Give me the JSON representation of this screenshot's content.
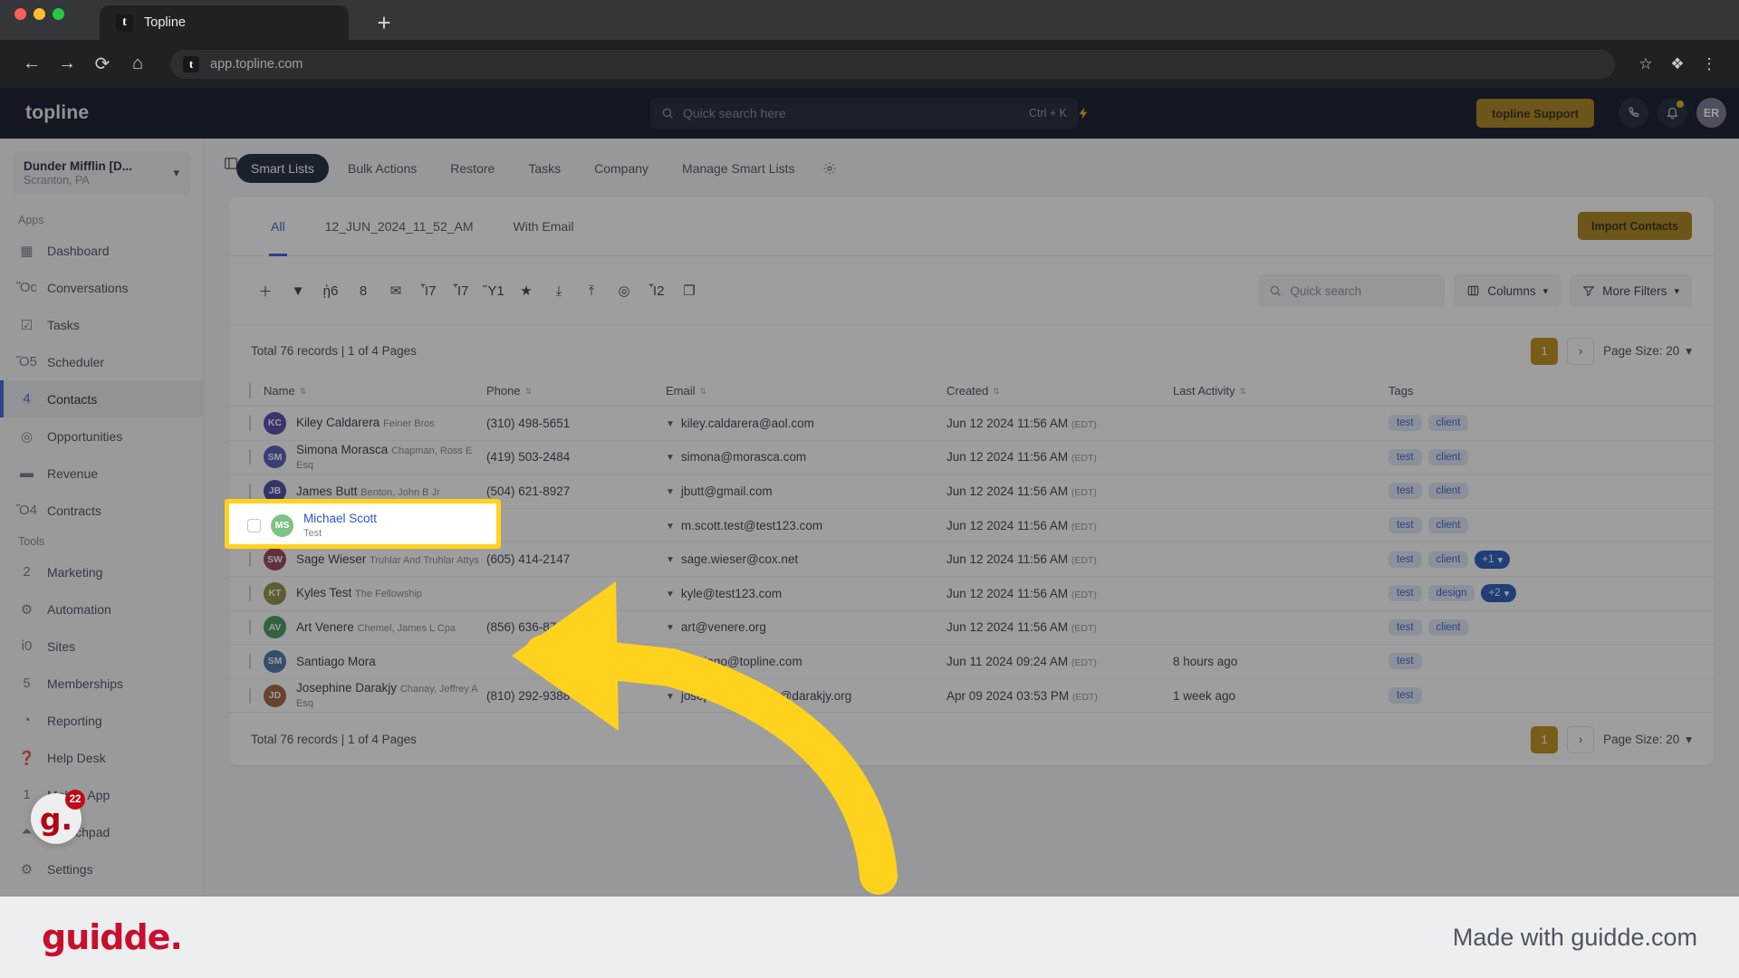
{
  "browser": {
    "tab_title": "Topline",
    "tab_favicon_letter": "t",
    "new_tab_label": "+",
    "url": "app.topline.com",
    "url_favicon_letter": "t",
    "nav": {
      "back": "←",
      "forward": "→",
      "reload": "⟳",
      "home": "⌂"
    },
    "omni": {
      "star": "☆",
      "extensions": "❖",
      "menu": "⋮"
    }
  },
  "topbar": {
    "brand": "topline",
    "search_placeholder": "Quick search here",
    "search_shortcut": "Ctrl + K",
    "bolt_icon": "⚡",
    "support_button": "topline Support",
    "phone_icon": "✆",
    "bell_icon": "ὑ4",
    "avatar_initials": "ER"
  },
  "sidebar": {
    "org_name": "Dunder Mifflin [D...",
    "org_location": "Scranton, PA",
    "org_chevron": "⌄",
    "collapse_icon": "◫",
    "section_apps": "Apps",
    "section_tools": "Tools",
    "apps": [
      {
        "label": "Dashboard",
        "icon": "▦",
        "active": false
      },
      {
        "label": "Conversations",
        "icon": "Ὂc",
        "active": false
      },
      {
        "label": "Tasks",
        "icon": "☑",
        "active": false
      },
      {
        "label": "Scheduler",
        "icon": "Ὄ5",
        "active": false
      },
      {
        "label": "Contacts",
        "icon": "὆4",
        "active": true
      },
      {
        "label": "Opportunities",
        "icon": "◎",
        "active": false
      },
      {
        "label": "Revenue",
        "icon": "▬",
        "active": false
      },
      {
        "label": "Contracts",
        "icon": "Ὄ4",
        "active": false
      }
    ],
    "tools": [
      {
        "label": "Marketing",
        "icon": "὎2",
        "active": false
      },
      {
        "label": "Automation",
        "icon": "⚙",
        "active": false
      },
      {
        "label": "Sites",
        "icon": "ἱ0",
        "active": false
      },
      {
        "label": "Memberships",
        "icon": "὆5",
        "active": false
      },
      {
        "label": "Reporting",
        "icon": "◔",
        "active": false
      },
      {
        "label": "Help Desk",
        "icon": "❓",
        "active": false
      },
      {
        "label": "Mobile App",
        "icon": "὏1",
        "active": false
      },
      {
        "label": "Launchpad",
        "icon": "⏶",
        "active": false
      },
      {
        "label": "Settings",
        "icon": "⚙",
        "active": false
      }
    ],
    "guidde_widget_letter": "g.",
    "guidde_widget_badge": "22"
  },
  "main": {
    "nav_tabs": [
      {
        "label": "Smart Lists",
        "active": true
      },
      {
        "label": "Bulk Actions",
        "active": false
      },
      {
        "label": "Restore",
        "active": false
      },
      {
        "label": "Tasks",
        "active": false
      },
      {
        "label": "Company",
        "active": false
      },
      {
        "label": "Manage Smart Lists",
        "active": false
      }
    ],
    "nav_gear_icon": "⚙",
    "filter_tabs": [
      {
        "label": "All",
        "active": true
      },
      {
        "label": "12_JUN_2024_11_52_AM",
        "active": false
      },
      {
        "label": "With Email",
        "active": false
      }
    ],
    "import_button": "Import Contacts",
    "toolbar_icons": [
      {
        "name": "add-contact-icon",
        "glyph": "＋"
      },
      {
        "name": "filter-icon",
        "glyph": "▼"
      },
      {
        "name": "bot-icon",
        "glyph": "ᾑ6"
      },
      {
        "name": "sms-icon",
        "glyph": "὞8"
      },
      {
        "name": "email-icon",
        "glyph": "✉"
      },
      {
        "name": "add-tag-icon",
        "glyph": "Ἷ7"
      },
      {
        "name": "remove-tag-icon",
        "glyph": "Ἷ7"
      },
      {
        "name": "delete-icon",
        "glyph": "Ὕ1"
      },
      {
        "name": "favorite-icon",
        "glyph": "★"
      },
      {
        "name": "import-icon",
        "glyph": "⤓"
      },
      {
        "name": "export-icon",
        "glyph": "⤒"
      },
      {
        "name": "assign-owner-icon",
        "glyph": "◎"
      },
      {
        "name": "merge-icon",
        "glyph": "Ἶ2"
      },
      {
        "name": "restore-icon",
        "glyph": "❐"
      }
    ],
    "toolbar_search_placeholder": "Quick search",
    "columns_button": "Columns",
    "more_filters_button": "More Filters",
    "columns_icon": "⌸",
    "filter_funnel_icon": "▽",
    "chevron_down": "⌄",
    "records_summary": "Total 76 records | 1 of 4 Pages",
    "pagination": {
      "current_page": "1",
      "next_icon": "›",
      "page_size_label": "Page Size: 20",
      "page_size_chevron": "▾"
    },
    "table": {
      "headers": [
        "Name",
        "Phone",
        "Email",
        "Created",
        "Last Activity",
        "Tags"
      ],
      "sort_icon": "⇅",
      "rows": [
        {
          "initials": "KC",
          "avatar_color": "#4a3fa8",
          "name": "Kiley Caldarera",
          "company": "Feiner Bros",
          "phone": "(310) 498-5651",
          "email": "kiley.caldarera@aol.com",
          "created": "Jun 12 2024 11:56 AM",
          "tz": "(EDT)",
          "last_activity": "",
          "tags": [
            "test",
            "client"
          ],
          "more_tags": ""
        },
        {
          "initials": "SM",
          "avatar_color": "#4a51b5",
          "name": "Simona Morasca",
          "company": "Chapman, Ross E Esq",
          "phone": "(419) 503-2484",
          "email": "simona@morasca.com",
          "created": "Jun 12 2024 11:56 AM",
          "tz": "(EDT)",
          "last_activity": "",
          "tags": [
            "test",
            "client"
          ],
          "more_tags": ""
        },
        {
          "initials": "JB",
          "avatar_color": "#3d3f9e",
          "name": "James Butt",
          "company": "Benton, John B Jr",
          "phone": "(504) 621-8927",
          "email": "jbutt@gmail.com",
          "created": "Jun 12 2024 11:56 AM",
          "tz": "(EDT)",
          "last_activity": "",
          "tags": [
            "test",
            "client"
          ],
          "more_tags": ""
        },
        {
          "initials": "MS",
          "avatar_color": "#7dc383",
          "name": "Michael Scott",
          "company": "Test",
          "phone": "",
          "email": "m.scott.test@test123.com",
          "created": "Jun 12 2024 11:56 AM",
          "tz": "(EDT)",
          "last_activity": "",
          "tags": [
            "test",
            "client"
          ],
          "more_tags": "",
          "highlighted": true
        },
        {
          "initials": "SW",
          "avatar_color": "#8c3a4e",
          "name": "Sage Wieser",
          "company": "Truhlar And Truhlar Attys",
          "phone": "(605) 414-2147",
          "email": "sage.wieser@cox.net",
          "created": "Jun 12 2024 11:56 AM",
          "tz": "(EDT)",
          "last_activity": "",
          "tags": [
            "test",
            "client"
          ],
          "more_tags": "+1"
        },
        {
          "initials": "KT",
          "avatar_color": "#8b8737",
          "name": "Kyles Test",
          "company": "The Fellowship",
          "phone": "",
          "email": "kyle@test123.com",
          "created": "Jun 12 2024 11:56 AM",
          "tz": "(EDT)",
          "last_activity": "",
          "tags": [
            "test",
            "design"
          ],
          "more_tags": "+2"
        },
        {
          "initials": "AV",
          "avatar_color": "#3c9355",
          "name": "Art Venere",
          "company": "Chemel, James L Cpa",
          "phone": "(856) 636-8749",
          "email": "art@venere.org",
          "created": "Jun 12 2024 11:56 AM",
          "tz": "(EDT)",
          "last_activity": "",
          "tags": [
            "test",
            "client"
          ],
          "more_tags": ""
        },
        {
          "initials": "SM",
          "avatar_color": "#3f6aa8",
          "name": "Santiago Mora",
          "company": "",
          "phone": "",
          "email": "santiago@topline.com",
          "created": "Jun 11 2024 09:24 AM",
          "tz": "(EDT)",
          "last_activity": "8 hours ago",
          "tags": [
            "test"
          ],
          "more_tags": ""
        },
        {
          "initials": "JD",
          "avatar_color": "#9c5a34",
          "name": "Josephine Darakjy",
          "company": "Chanay, Jeffrey A Esq",
          "phone": "(810) 292-9388",
          "email": "josephine_darakjy@darakjy.org",
          "created": "Apr 09 2024 03:53 PM",
          "tz": "(EDT)",
          "last_activity": "1 week ago",
          "tags": [
            "test"
          ],
          "more_tags": ""
        }
      ]
    },
    "footer_records_summary": "Total 76 records | 1 of 4 Pages",
    "footer_pagination": {
      "current_page": "1",
      "next_icon": "›",
      "page_size_label": "Page Size: 20",
      "page_size_chevron": "▾"
    }
  },
  "guidde_footer": {
    "logo": "guidde.",
    "made_with": "Made with guidde.com"
  },
  "colors": {
    "accent_gold": "#a67d0e",
    "link_blue": "#2b55c9",
    "dark_navy": "#030a1d",
    "highlight_yellow": "#ffd21e",
    "guidde_red": "#c8102e"
  }
}
